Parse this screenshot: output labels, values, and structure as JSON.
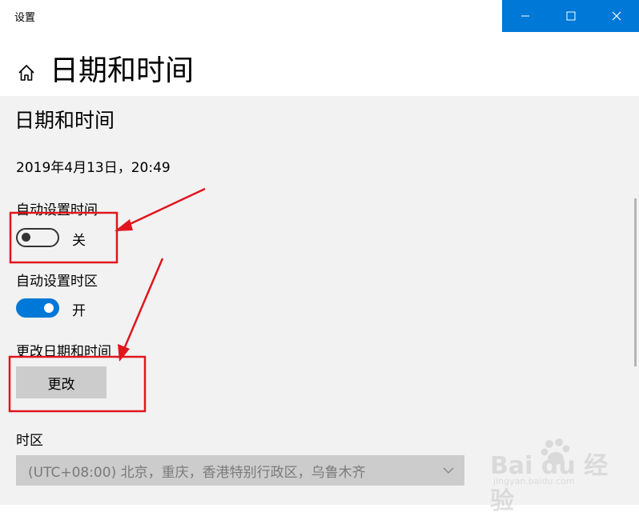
{
  "window": {
    "app_title": "设置",
    "controls": {
      "minimize": "minimize-icon",
      "maximize": "maximize-icon",
      "close": "close-icon"
    },
    "accent_color": "#0078d7"
  },
  "header": {
    "home_icon": "home-icon",
    "page_title": "日期和时间"
  },
  "main": {
    "section_title": "日期和时间",
    "current_datetime": "2019年4月13日，20:49",
    "auto_time": {
      "label": "自动设置时间",
      "state": "关",
      "on": false
    },
    "auto_timezone": {
      "label": "自动设置时区",
      "state": "开",
      "on": true
    },
    "change_datetime": {
      "label": "更改日期和时间",
      "button": "更改"
    },
    "timezone": {
      "label": "时区",
      "selected": "(UTC+08:00) 北京，重庆，香港特别行政区，乌鲁木齐"
    }
  },
  "watermark": {
    "text": "Bai du 经验",
    "sub": "jingyan.baidu.com"
  },
  "annotation_color": "#e0161e"
}
